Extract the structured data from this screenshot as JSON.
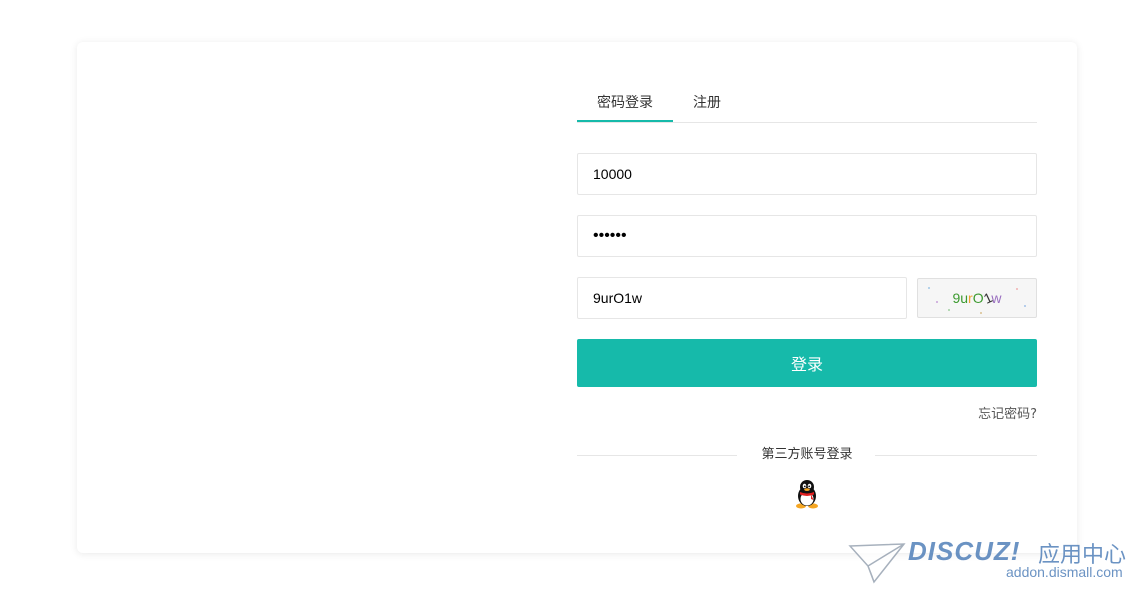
{
  "tabs": [
    {
      "label": "密码登录",
      "active": true
    },
    {
      "label": "注册",
      "active": false
    }
  ],
  "form": {
    "username_value": "10000",
    "password_value": "••••••",
    "captcha_value": "9urO1w",
    "captcha_chars": [
      {
        "ch": "9",
        "color": "#3c9a2f"
      },
      {
        "ch": "u",
        "color": "#3c9a2f"
      },
      {
        "ch": "r",
        "color": "#f0a030"
      },
      {
        "ch": "O",
        "color": "#3c9a2f"
      },
      {
        "ch": "1",
        "color": "#333333"
      },
      {
        "ch": "w",
        "color": "#9a6fc0"
      }
    ],
    "login_label": "登录",
    "forgot_label": "忘记密码?",
    "third_party_label": "第三方账号登录"
  },
  "colors": {
    "accent": "#16baaa",
    "border": "#e6e6e6"
  },
  "icons": {
    "third_party": "qq-penguin-icon"
  },
  "watermark": {
    "brand": "DISCUZ!",
    "brand_cn": "应用中心",
    "url": "addon.dismall.com"
  }
}
